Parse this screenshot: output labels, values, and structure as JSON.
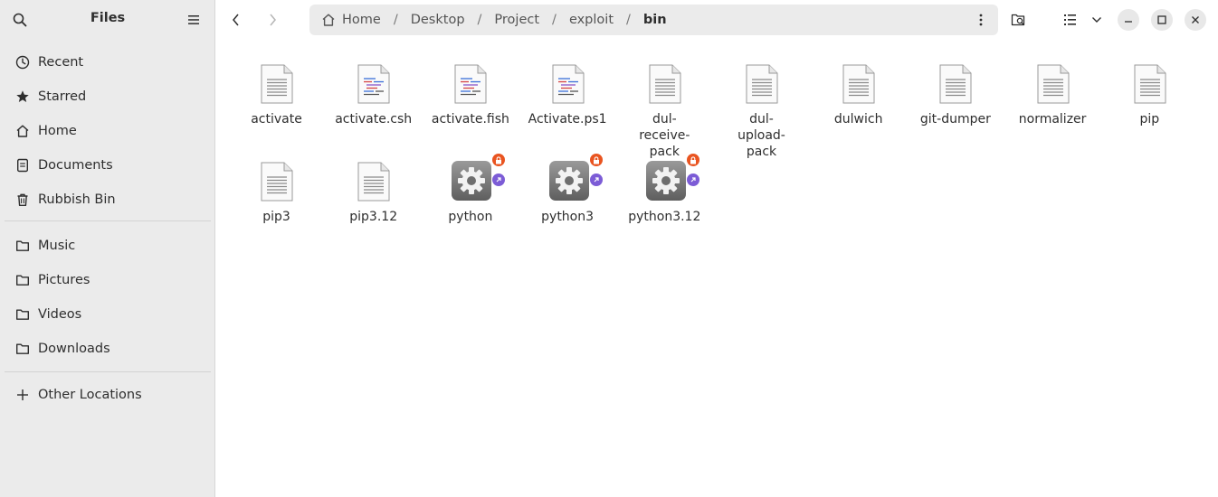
{
  "sidebar": {
    "title": "Files",
    "items": [
      {
        "label": "Recent",
        "icon": "clock-icon"
      },
      {
        "label": "Starred",
        "icon": "star-icon"
      },
      {
        "label": "Home",
        "icon": "home-icon"
      },
      {
        "label": "Documents",
        "icon": "document-icon"
      },
      {
        "label": "Rubbish Bin",
        "icon": "trash-icon"
      },
      {
        "label": "Music",
        "icon": "folder-icon"
      },
      {
        "label": "Pictures",
        "icon": "folder-icon"
      },
      {
        "label": "Videos",
        "icon": "folder-icon"
      },
      {
        "label": "Downloads",
        "icon": "folder-icon"
      },
      {
        "label": "Other Locations",
        "icon": "plus-icon"
      }
    ]
  },
  "path": {
    "crumbs": [
      "Home",
      "Desktop",
      "Project",
      "exploit",
      "bin"
    ]
  },
  "files": [
    {
      "name": "activate",
      "type": "text"
    },
    {
      "name": "activate.csh",
      "type": "script"
    },
    {
      "name": "activate.fish",
      "type": "script"
    },
    {
      "name": "Activate.ps1",
      "type": "script"
    },
    {
      "name": "dul-receive-pack",
      "type": "text"
    },
    {
      "name": "dul-upload-pack",
      "type": "text"
    },
    {
      "name": "dulwich",
      "type": "text"
    },
    {
      "name": "git-dumper",
      "type": "text"
    },
    {
      "name": "normalizer",
      "type": "text"
    },
    {
      "name": "pip",
      "type": "text"
    },
    {
      "name": "pip3",
      "type": "text"
    },
    {
      "name": "pip3.12",
      "type": "text"
    },
    {
      "name": "python",
      "type": "executable-link"
    },
    {
      "name": "python3",
      "type": "executable-link"
    },
    {
      "name": "python3.12",
      "type": "executable-link"
    }
  ],
  "colors": {
    "lock_badge": "#e95420",
    "link_badge": "#7c5cd6",
    "sidebar_bg": "#ebebeb"
  }
}
